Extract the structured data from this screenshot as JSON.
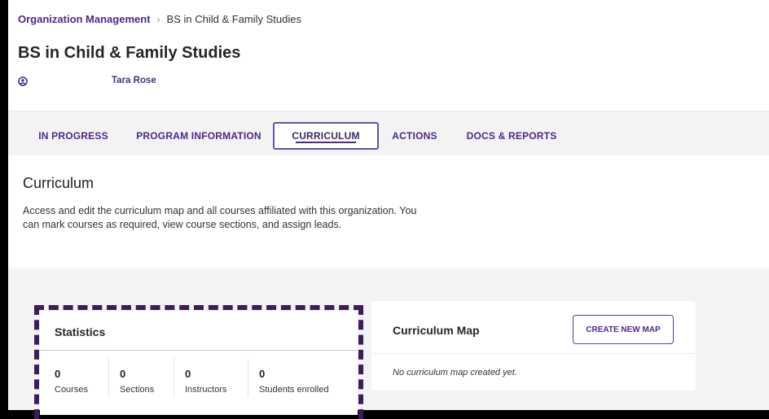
{
  "breadcrumb": {
    "root": "Organization Management",
    "separator": "›",
    "current": "BS in Child & Family Studies"
  },
  "page": {
    "title": "BS in Child & Family Studies",
    "owner_icon": "user-circle-icon",
    "owner_name": "Tara Rose"
  },
  "tabs": [
    {
      "label": "IN PROGRESS",
      "active": false
    },
    {
      "label": "PROGRAM INFORMATION",
      "active": false
    },
    {
      "label": "CURRICULUM",
      "active": true
    },
    {
      "label": "ACTIONS",
      "active": false
    },
    {
      "label": "DOCS & REPORTS",
      "active": false
    }
  ],
  "curriculum": {
    "heading": "Curriculum",
    "description": "Access and edit the curriculum map and all courses affiliated with this organization. You can mark courses as required, view course sections, and assign leads."
  },
  "statistics": {
    "title": "Statistics",
    "items": [
      {
        "value": "0",
        "label": "Courses"
      },
      {
        "value": "0",
        "label": "Sections"
      },
      {
        "value": "0",
        "label": "Instructors"
      },
      {
        "value": "0",
        "label": "Students enrolled"
      }
    ]
  },
  "curriculum_map": {
    "title": "Curriculum Map",
    "button_label": "CREATE NEW MAP",
    "empty_message": "No curriculum map created yet."
  },
  "colors": {
    "brand_purple": "#4b2a8c",
    "highlight_dashes": "#3f1b5c",
    "panel_gray": "#f3f3f3"
  }
}
